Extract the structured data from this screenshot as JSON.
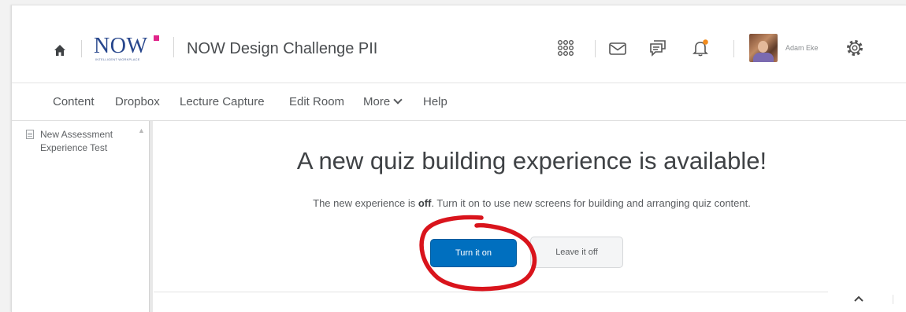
{
  "header": {
    "home_icon": "home-icon",
    "logo": {
      "text": "NOW",
      "tagline": "INTELLIGENT WORKPLACE",
      "accent_color": "#e0248a",
      "color": "#27468c"
    },
    "course_title": "NOW Design Challenge PII",
    "icons": [
      "waffle-grid-icon",
      "mail-icon",
      "chat-icon",
      "bell-icon",
      "gear-icon"
    ],
    "notification_dot_color": "#f28c1e",
    "user": {
      "name": "Adam Eke"
    }
  },
  "nav": {
    "items": [
      "Content",
      "Dropbox",
      "Lecture Capture",
      "Edit Room",
      "More",
      "Help"
    ]
  },
  "sidebar": {
    "items": [
      {
        "label": "New Assessment Experience Test",
        "icon": "document-icon"
      }
    ]
  },
  "main": {
    "headline": "A new quiz building experience is available!",
    "description": {
      "prefix": "The new experience is ",
      "emphasis": "off",
      "suffix": ". Turn it on to use new screens for building and arranging quiz content."
    },
    "primary_button": "Turn it on",
    "secondary_button": "Leave it off",
    "primary_color": "#006fbf",
    "annotation_color": "#d9141c"
  }
}
